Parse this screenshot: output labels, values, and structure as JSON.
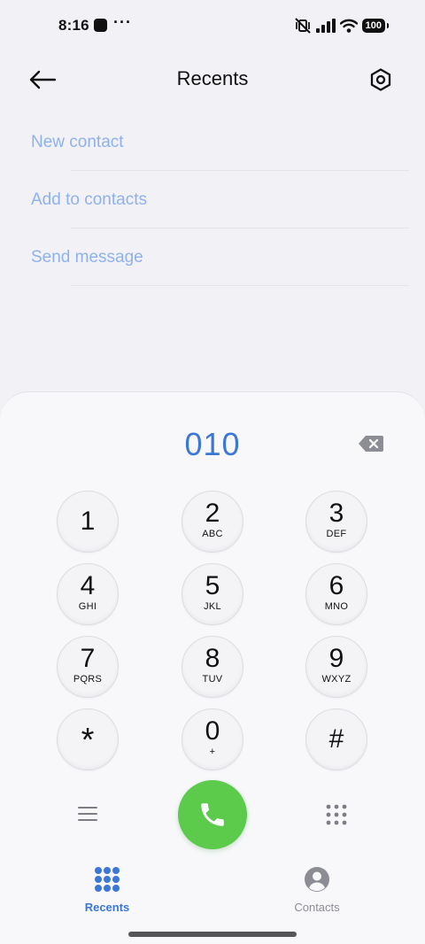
{
  "status_bar": {
    "time": "8:16",
    "more": "···",
    "battery": "100"
  },
  "header": {
    "title": "Recents",
    "back_icon": "arrow-left-icon",
    "settings_icon": "hexagon-gear-icon"
  },
  "menu": {
    "items": [
      {
        "label": "New contact"
      },
      {
        "label": "Add to contacts"
      },
      {
        "label": "Send message"
      }
    ]
  },
  "dialer": {
    "number": "010",
    "keys": [
      {
        "digit": "1",
        "letters": ""
      },
      {
        "digit": "2",
        "letters": "ABC"
      },
      {
        "digit": "3",
        "letters": "DEF"
      },
      {
        "digit": "4",
        "letters": "GHI"
      },
      {
        "digit": "5",
        "letters": "JKL"
      },
      {
        "digit": "6",
        "letters": "MNO"
      },
      {
        "digit": "7",
        "letters": "PQRS"
      },
      {
        "digit": "8",
        "letters": "TUV"
      },
      {
        "digit": "9",
        "letters": "WXYZ"
      },
      {
        "digit": "*",
        "letters": ""
      },
      {
        "digit": "0",
        "letters": "+"
      },
      {
        "digit": "#",
        "letters": ""
      }
    ]
  },
  "bottom_nav": {
    "recents_label": "Recents",
    "contacts_label": "Contacts"
  },
  "colors": {
    "accent": "#3b76d9",
    "menu_text": "#8fb2ee",
    "call_green": "#5ccb4c"
  }
}
